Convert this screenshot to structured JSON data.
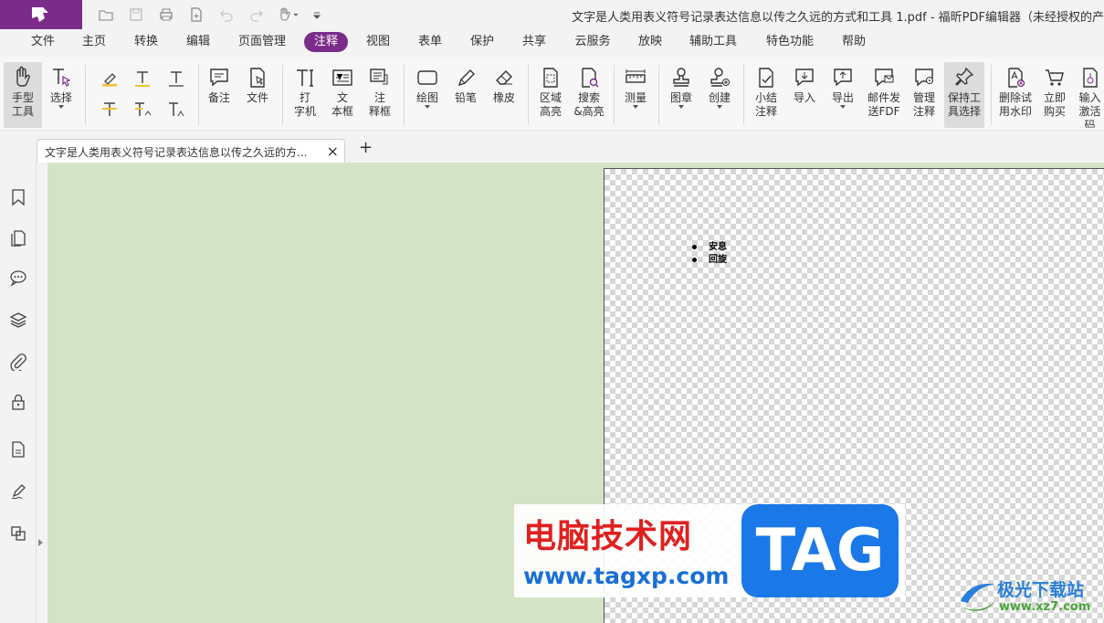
{
  "window": {
    "title": "文字是人类用表义符号记录表达信息以传之久远的方式和工具 1.pdf - 福昕PDF编辑器（未经授权的产"
  },
  "menu": [
    "文件",
    "主页",
    "转换",
    "编辑",
    "页面管理",
    "注释",
    "视图",
    "表单",
    "保护",
    "共享",
    "云服务",
    "放映",
    "辅助工具",
    "特色功能",
    "帮助"
  ],
  "active_menu": "注释",
  "ribbon": {
    "hand_tool": "手型\n工具",
    "select": "选择",
    "note": "备注",
    "file": "文件",
    "typewriter": "打\n字机",
    "textbox": "文\n本框",
    "callout": "注\n释框",
    "drawing": "绘图",
    "pencil": "铅笔",
    "eraser": "橡皮",
    "area_highlight": "区域\n高亮",
    "search_highlight": "搜索\n&高亮",
    "measure": "测量",
    "stamp": "图章",
    "create": "创建",
    "summarize": "小结\n注释",
    "import": "导入",
    "export": "导出",
    "email_fdf": "邮件发\n送FDF",
    "manage": "管理\n注释",
    "keep_tool": "保持工\n具选择",
    "remove_watermark": "删除试\n用水印",
    "buy_now": "立即\n购买",
    "activate": "输入\n激活码"
  },
  "tab": {
    "label": "文字是人类用表义符号记录表达信息以传之久远的方...",
    "close": "×",
    "new": "+"
  },
  "document": {
    "bullets": [
      "安息",
      "回旋"
    ]
  },
  "watermark": {
    "title": "电脑技术网",
    "url": "www.tagxp.com",
    "tag": "TAG",
    "site_name": "极光下载站",
    "site_url": "www.xz7.com"
  },
  "colors": {
    "brand": "#7b2c8b",
    "canvas_bg": "#d4e3c8"
  }
}
